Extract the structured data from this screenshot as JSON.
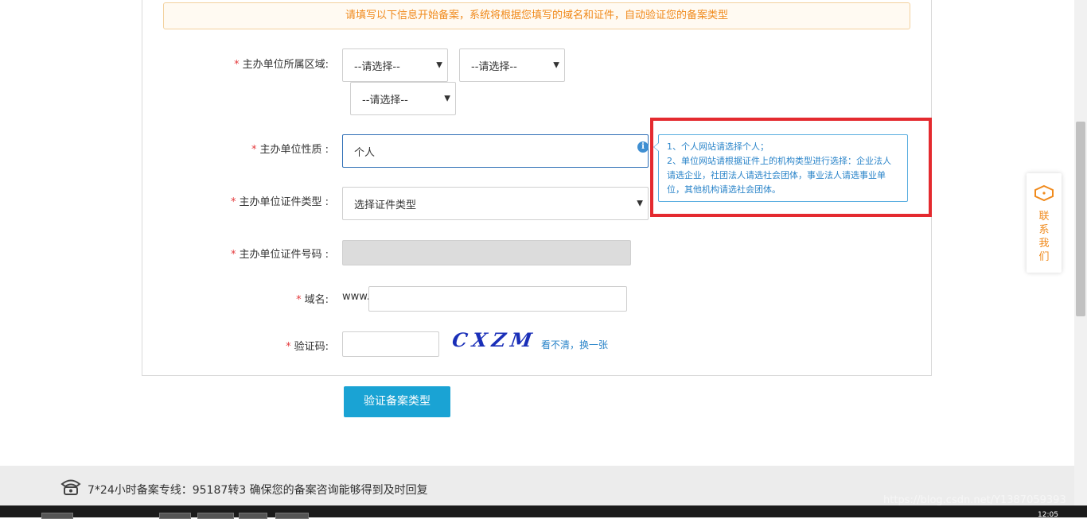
{
  "notice": "请填写以下信息开始备案，系统将根据您填写的域名和证件，自动验证您的备案类型",
  "form": {
    "region": {
      "label": "主办单位所属区域:",
      "select1": "--请选择--",
      "select2": "--请选择--",
      "select3": "--请选择--"
    },
    "nature": {
      "label": "主办单位性质 :",
      "value": "个人"
    },
    "cert_type": {
      "label": "主办单位证件类型 :",
      "value": "选择证件类型"
    },
    "cert_number": {
      "label": "主办单位证件号码 :"
    },
    "domain": {
      "label": "域名:",
      "prefix": "www."
    },
    "captcha": {
      "label": "验证码:",
      "image_text": "CXZM",
      "refresh": "看不清，换一张"
    },
    "required_mark": "*"
  },
  "tooltip": {
    "line1": "1、个人网站请选择个人；",
    "line2": "2、单位网站请根据证件上的机构类型进行选择：企业法人请选企业，社团法人请选社会团体，事业法人请选事业单位，其他机构请选社会团体。"
  },
  "submit_label": "验证备案类型",
  "footer": {
    "hotline": "7*24小时备案专线：95187转3 确保您的备案咨询能够得到及时回复"
  },
  "contact": {
    "chars": [
      "联",
      "系",
      "我",
      "们"
    ]
  },
  "watermark": "https://blog.csdn.net/Y1387059393",
  "clock": "12:05",
  "colors": {
    "accent": "#1aa3d4",
    "notice": "#f08a1c",
    "highlight": "#e42a2f",
    "required": "#e4393c"
  }
}
